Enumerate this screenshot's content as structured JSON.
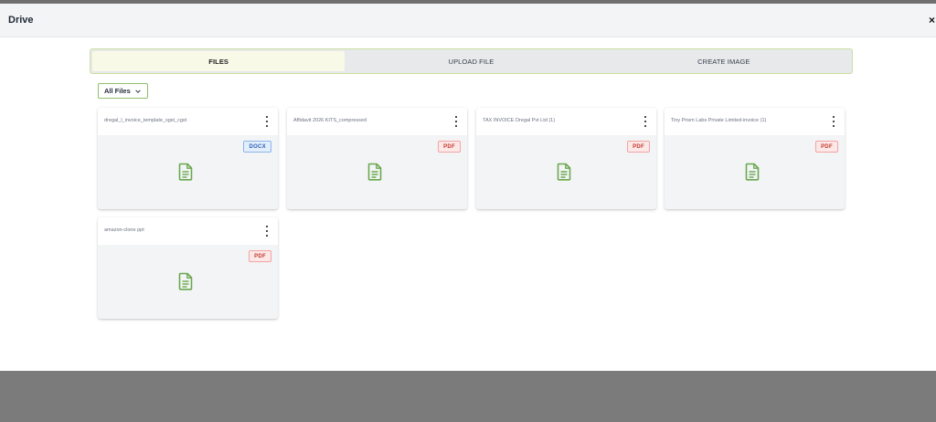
{
  "modal": {
    "title": "Drive",
    "close_symbol": "×"
  },
  "tabs": [
    {
      "label": "FILES",
      "active": true
    },
    {
      "label": "UPLOAD FILE",
      "active": false
    },
    {
      "label": "CREATE IMAGE",
      "active": false
    }
  ],
  "filter": {
    "label": "All Files",
    "icon": "chevron-down-icon"
  },
  "files": [
    {
      "name": "dregal_l_invoice_template_sgst_cgst",
      "type": "DOCX"
    },
    {
      "name": "Affidavit 2026 KITS_compressed",
      "type": "PDF"
    },
    {
      "name": "TAX INVOICE Dregal Pvt Ltd (1)",
      "type": "PDF"
    },
    {
      "name": "Tiny Prism Labs Private Limited-invoice (1)",
      "type": "PDF"
    },
    {
      "name": "amazon-clone ppt",
      "type": "PDF"
    }
  ],
  "colors": {
    "accent_green": "#6aa84f",
    "tab_border": "#c9e0a0",
    "pdf_red": "#c0392b",
    "docx_blue": "#2b5fb3",
    "overlay": "#7b7b7b"
  }
}
